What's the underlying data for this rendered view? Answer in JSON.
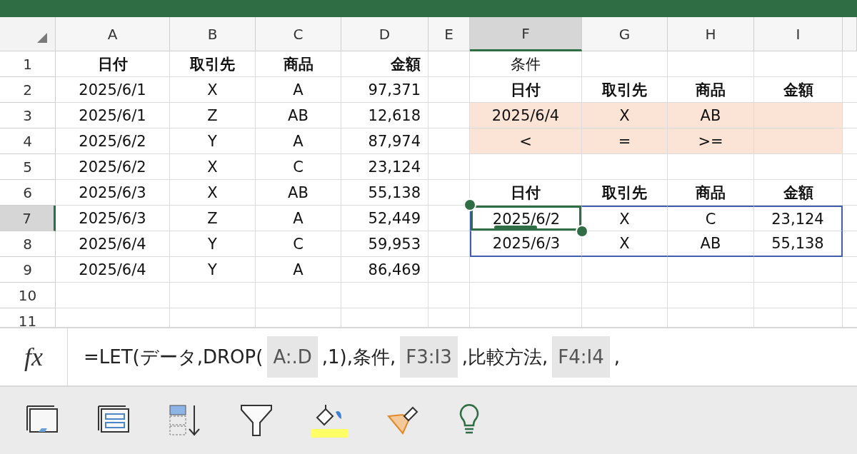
{
  "columns": [
    {
      "label": "A",
      "selected": false
    },
    {
      "label": "B",
      "selected": false
    },
    {
      "label": "C",
      "selected": false
    },
    {
      "label": "D",
      "selected": false
    },
    {
      "label": "E",
      "selected": false
    },
    {
      "label": "F",
      "selected": true
    },
    {
      "label": "G",
      "selected": false
    },
    {
      "label": "H",
      "selected": false
    },
    {
      "label": "I",
      "selected": false
    }
  ],
  "rows": [
    {
      "number": "1",
      "selected": false,
      "cells": [
        {
          "text": "日付",
          "bold": true
        },
        {
          "text": "取引先",
          "bold": true
        },
        {
          "text": "商品",
          "bold": true
        },
        {
          "text": "金額",
          "bold": true
        },
        null,
        {
          "text": "条件"
        },
        null,
        null,
        null
      ]
    },
    {
      "number": "2",
      "selected": false,
      "cells": [
        {
          "text": "2025/6/1"
        },
        {
          "text": "X"
        },
        {
          "text": "A"
        },
        {
          "text": "97,371"
        },
        null,
        {
          "text": "日付",
          "bold": true
        },
        {
          "text": "取引先",
          "bold": true
        },
        {
          "text": "商品",
          "bold": true
        },
        {
          "text": "金額",
          "bold": true
        }
      ]
    },
    {
      "number": "3",
      "selected": false,
      "cells": [
        {
          "text": "2025/6/1"
        },
        {
          "text": "Z"
        },
        {
          "text": "AB"
        },
        {
          "text": "12,618"
        },
        null,
        {
          "text": "2025/6/4",
          "shaded": true
        },
        {
          "text": "X",
          "shaded": true
        },
        {
          "text": "AB",
          "shaded": true
        },
        {
          "shaded": true
        }
      ]
    },
    {
      "number": "4",
      "selected": false,
      "cells": [
        {
          "text": "2025/6/2"
        },
        {
          "text": "Y"
        },
        {
          "text": "A"
        },
        {
          "text": "87,974"
        },
        null,
        {
          "text": "<",
          "shaded": true
        },
        {
          "text": "=",
          "shaded": true
        },
        {
          "text": ">=",
          "shaded": true
        },
        {
          "shaded": true
        }
      ]
    },
    {
      "number": "5",
      "selected": false,
      "cells": [
        {
          "text": "2025/6/2"
        },
        {
          "text": "X"
        },
        {
          "text": "C"
        },
        {
          "text": "23,124"
        },
        null,
        null,
        null,
        null,
        null
      ]
    },
    {
      "number": "6",
      "selected": false,
      "cells": [
        {
          "text": "2025/6/3"
        },
        {
          "text": "X"
        },
        {
          "text": "AB"
        },
        {
          "text": "55,138"
        },
        null,
        {
          "text": "日付",
          "bold": true
        },
        {
          "text": "取引先",
          "bold": true
        },
        {
          "text": "商品",
          "bold": true
        },
        {
          "text": "金額",
          "bold": true
        }
      ]
    },
    {
      "number": "7",
      "selected": true,
      "cells": [
        {
          "text": "2025/6/3"
        },
        {
          "text": "Z"
        },
        {
          "text": "A"
        },
        {
          "text": "52,449"
        },
        null,
        {
          "text": "2025/6/2",
          "active": true,
          "spill": true
        },
        {
          "text": "X",
          "spill": true
        },
        {
          "text": "C",
          "spill": true
        },
        {
          "text": "23,124",
          "spill": true
        }
      ]
    },
    {
      "number": "8",
      "selected": false,
      "cells": [
        {
          "text": "2025/6/4"
        },
        {
          "text": "Y"
        },
        {
          "text": "C"
        },
        {
          "text": "59,953"
        },
        null,
        {
          "text": "2025/6/3",
          "spill": true
        },
        {
          "text": "X",
          "spill": true
        },
        {
          "text": "AB",
          "spill": true
        },
        {
          "text": "55,138",
          "spill": true
        }
      ]
    },
    {
      "number": "9",
      "selected": false,
      "cells": [
        {
          "text": "2025/6/4"
        },
        {
          "text": "Y"
        },
        {
          "text": "A"
        },
        {
          "text": "86,469"
        },
        null,
        null,
        null,
        null,
        null
      ]
    },
    {
      "number": "10",
      "selected": false,
      "cells": [
        null,
        null,
        null,
        null,
        null,
        null,
        null,
        null,
        null
      ]
    },
    {
      "number": "11",
      "selected": false,
      "cells": [
        null,
        null,
        null,
        null,
        null,
        null,
        null,
        null,
        null
      ]
    }
  ],
  "formula_bar": {
    "label": "fx",
    "parts": [
      {
        "kind": "text",
        "text": "=LET(データ,DROP("
      },
      {
        "kind": "ref",
        "text": "A:.D"
      },
      {
        "kind": "text",
        "text": ",1),条件,"
      },
      {
        "kind": "ref",
        "text": "F3:I3"
      },
      {
        "kind": "text",
        "text": ",比較方法,"
      },
      {
        "kind": "ref",
        "text": "F4:I4"
      },
      {
        "kind": "text",
        "text": ","
      }
    ]
  }
}
